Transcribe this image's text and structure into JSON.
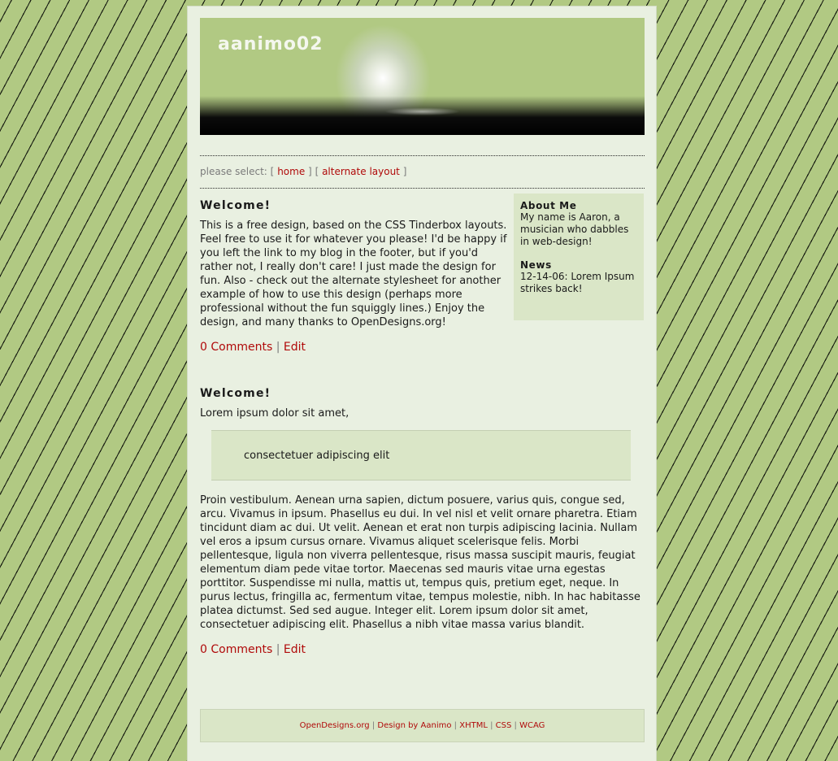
{
  "site": {
    "title": "aanimo02"
  },
  "nav": {
    "prefix": "please select:",
    "open1": "[",
    "home": "home",
    "close1": "]",
    "open2": "[",
    "alternate": "alternate layout",
    "close2": "]"
  },
  "posts": [
    {
      "title": "Welcome!",
      "body": "This is a free design, based on the CSS Tinderbox layouts. Feel free to use it for whatever you please! I'd be happy if you left the link to my blog in the footer, but if you'd rather not, I really don't care! I just made the design for fun. Also - check out the alternate stylesheet for another example of how to use this design (perhaps more professional without the fun squiggly lines.) Enjoy the design, and many thanks to OpenDesigns.org!",
      "comments": "0 Comments",
      "separator": "|",
      "edit": "Edit"
    },
    {
      "title": "Welcome!",
      "intro": "Lorem ipsum dolor sit amet,",
      "quote": "consectetuer adipiscing elit",
      "body": "Proin vestibulum. Aenean urna sapien, dictum posuere, varius quis, congue sed, arcu. Vivamus in ipsum. Phasellus eu dui. In vel nisl et velit ornare pharetra. Etiam tincidunt diam ac dui. Ut velit. Aenean et erat non turpis adipiscing lacinia. Nullam vel eros a ipsum cursus ornare. Vivamus aliquet scelerisque felis. Morbi pellentesque, ligula non viverra pellentesque, risus massa suscipit mauris, feugiat elementum diam pede vitae tortor. Maecenas sed mauris vitae urna egestas porttitor. Suspendisse mi nulla, mattis ut, tempus quis, pretium eget, neque. In purus lectus, fringilla ac, fermentum vitae, tempus molestie, nibh. In hac habitasse platea dictumst. Sed sed augue. Integer elit. Lorem ipsum dolor sit amet, consectetuer adipiscing elit. Phasellus a nibh vitae massa varius blandit.",
      "comments": "0 Comments",
      "separator": "|",
      "edit": "Edit"
    }
  ],
  "sidebar": {
    "about_title": "About Me",
    "about_text": "My name is Aaron, a musician who dabbles in web-design!",
    "news_title": "News",
    "news_text": "12-14-06: Lorem Ipsum strikes back!"
  },
  "footer": {
    "links": [
      "OpenDesigns.org",
      "Design by Aanimo",
      "XHTML",
      "CSS",
      "WCAG"
    ],
    "separator": "|"
  },
  "colors": {
    "background": "#b1c983",
    "page": "#e9f0e1",
    "panel": "#dae6c7",
    "link": "#b00a0a"
  }
}
